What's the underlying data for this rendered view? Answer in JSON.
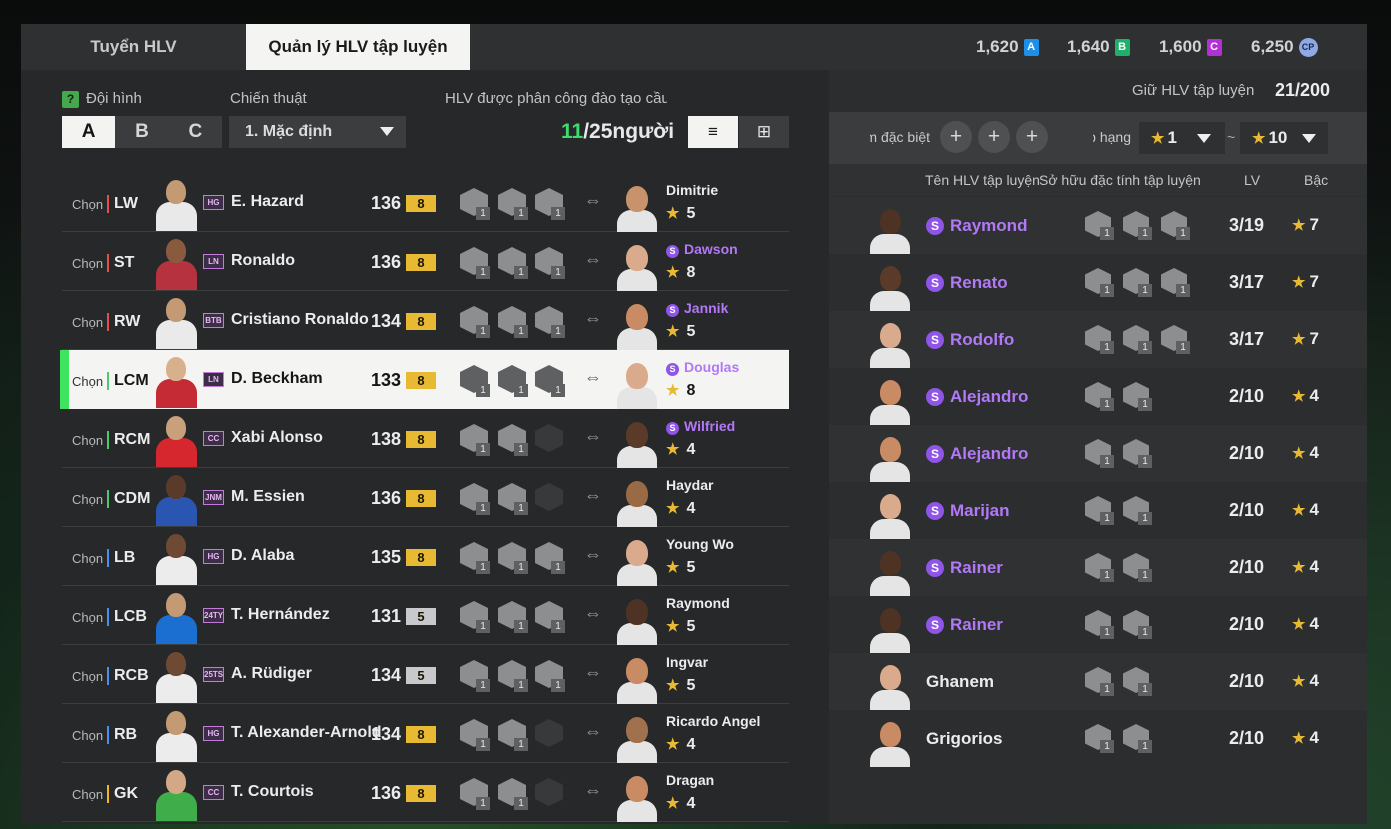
{
  "tabs": {
    "recruit": "Tuyển HLV",
    "manage": "Quản lý HLV tập luyện"
  },
  "currencies": [
    {
      "value": "1,620",
      "icon": "A",
      "color": "#1e8fe8"
    },
    {
      "value": "1,640",
      "icon": "B",
      "color": "#1fb06a"
    },
    {
      "value": "1,600",
      "icon": "C",
      "color": "#b32fd6"
    },
    {
      "value": "6,250",
      "icon": "CP",
      "color": "#8ea9e4"
    }
  ],
  "left": {
    "squad_label": "Đội hình",
    "help_icon": "?",
    "squads": [
      "A",
      "B",
      "C"
    ],
    "tactic_label": "Chiến thuật",
    "tactic_value": "1. Mặc định",
    "assigned_label": "HLV được phân công đào tạo cầu thủ",
    "assigned_count": "11",
    "assigned_total": "/25người",
    "view_list_icon": "≡",
    "view_field_icon": "⊞",
    "select_label": "Chọn"
  },
  "players": [
    {
      "pos": "LW",
      "line": "f",
      "card": "HG",
      "name": "E. Hazard",
      "ovr": "136",
      "lvl": "8",
      "grey": false,
      "coach": "Dimitrie",
      "coach_special": false,
      "coach_star": "5",
      "kit": "#e9e9e9",
      "skin": "#c49a75",
      "cskin": "#c8926a",
      "traits": 3,
      "sel": false
    },
    {
      "pos": "ST",
      "line": "f",
      "card": "LN",
      "name": "Ronaldo",
      "ovr": "136",
      "lvl": "8",
      "grey": false,
      "coach": "Dawson",
      "coach_special": true,
      "coach_star": "8",
      "kit": "#b7323f",
      "skin": "#8a5a3f",
      "cskin": "#d9ab8c",
      "traits": 3,
      "sel": false
    },
    {
      "pos": "RW",
      "line": "f",
      "card": "BTB",
      "name": "Cristiano Ronaldo",
      "ovr": "134",
      "lvl": "8",
      "grey": false,
      "coach": "Jannik",
      "coach_special": true,
      "coach_star": "5",
      "kit": "#eaeaea",
      "skin": "#c49a75",
      "cskin": "#c98b63",
      "traits": 3,
      "sel": false
    },
    {
      "pos": "LCM",
      "line": "m",
      "card": "LN",
      "name": "D. Beckham",
      "ovr": "133",
      "lvl": "8",
      "grey": false,
      "coach": "Douglas",
      "coach_special": true,
      "coach_star": "8",
      "kit": "#c42b34",
      "skin": "#d9b08c",
      "cskin": "#d9ab8c",
      "traits": 3,
      "sel": true
    },
    {
      "pos": "RCM",
      "line": "m",
      "card": "CC",
      "name": "Xabi Alonso",
      "ovr": "138",
      "lvl": "8",
      "grey": false,
      "coach": "Wilfried",
      "coach_special": true,
      "coach_star": "4",
      "kit": "#d6272e",
      "skin": "#c9a07c",
      "cskin": "#5a3a28",
      "traits": 2,
      "sel": false
    },
    {
      "pos": "CDM",
      "line": "m",
      "card": "JNM",
      "name": "M. Essien",
      "ovr": "136",
      "lvl": "8",
      "grey": false,
      "coach": "Haydar",
      "coach_special": false,
      "coach_star": "4",
      "kit": "#2a55b0",
      "skin": "#5a3a28",
      "cskin": "#9a6a45",
      "traits": 2,
      "sel": false
    },
    {
      "pos": "LB",
      "line": "d",
      "card": "HG",
      "name": "D. Alaba",
      "ovr": "135",
      "lvl": "8",
      "grey": false,
      "coach": "Young Wo",
      "coach_special": false,
      "coach_star": "5",
      "kit": "#ececec",
      "skin": "#6e4a34",
      "cskin": "#d9ab8c",
      "traits": 3,
      "sel": false
    },
    {
      "pos": "LCB",
      "line": "d",
      "card": "24TY",
      "name": "T. Hernández",
      "ovr": "131",
      "lvl": "5",
      "grey": true,
      "coach": "Raymond",
      "coach_special": false,
      "coach_star": "5",
      "kit": "#1a6fd1",
      "skin": "#c49a75",
      "cskin": "#4e3224",
      "traits": 3,
      "sel": false
    },
    {
      "pos": "RCB",
      "line": "d",
      "card": "25TS",
      "name": "A. Rüdiger",
      "ovr": "134",
      "lvl": "5",
      "grey": true,
      "coach": "Ingvar",
      "coach_special": false,
      "coach_star": "5",
      "kit": "#ececec",
      "skin": "#6e4a34",
      "cskin": "#c98b63",
      "traits": 3,
      "sel": false
    },
    {
      "pos": "RB",
      "line": "d",
      "card": "HG",
      "name": "T. Alexander-Arnold",
      "ovr": "134",
      "lvl": "8",
      "grey": false,
      "coach": "Ricardo Angel",
      "coach_special": false,
      "coach_star": "4",
      "kit": "#ececec",
      "skin": "#c49a75",
      "cskin": "#a0714c",
      "traits": 2,
      "sel": false
    },
    {
      "pos": "GK",
      "line": "g",
      "card": "CC",
      "name": "T. Courtois",
      "ovr": "136",
      "lvl": "8",
      "grey": false,
      "coach": "Dragan",
      "coach_special": false,
      "coach_star": "4",
      "kit": "#3fae4a",
      "skin": "#d3a886",
      "cskin": "#c98b63",
      "traits": 2,
      "sel": false
    }
  ],
  "right": {
    "keep_label": "Giữ HLV tập luyện",
    "keep_count": "21/200",
    "trait_filter_label": "Đặc điểm đặc biệt",
    "rank_label": "Xếp hạng",
    "rank_from": "1",
    "rank_sep": "~",
    "rank_to": "10",
    "headers": {
      "name": "Tên HLV tập luyện",
      "traits": "Sở hữu đặc tính tập luyện",
      "lv": "LV",
      "grade": "Bậc"
    }
  },
  "coaches": [
    {
      "name": "Raymond",
      "special": true,
      "lv": "3/19",
      "grade": "7",
      "traits": 3,
      "skin": "#4e3224"
    },
    {
      "name": "Renato",
      "special": true,
      "lv": "3/17",
      "grade": "7",
      "traits": 3,
      "skin": "#5a3a28"
    },
    {
      "name": "Rodolfo",
      "special": true,
      "lv": "3/17",
      "grade": "7",
      "traits": 3,
      "skin": "#d9ab8c"
    },
    {
      "name": "Alejandro",
      "special": true,
      "lv": "2/10",
      "grade": "4",
      "traits": 2,
      "skin": "#c98b63"
    },
    {
      "name": "Alejandro",
      "special": true,
      "lv": "2/10",
      "grade": "4",
      "traits": 2,
      "skin": "#c98b63"
    },
    {
      "name": "Marijan",
      "special": true,
      "lv": "2/10",
      "grade": "4",
      "traits": 2,
      "skin": "#d9ab8c"
    },
    {
      "name": "Rainer",
      "special": true,
      "lv": "2/10",
      "grade": "4",
      "traits": 2,
      "skin": "#4e3224"
    },
    {
      "name": "Rainer",
      "special": true,
      "lv": "2/10",
      "grade": "4",
      "traits": 2,
      "skin": "#4e3224"
    },
    {
      "name": "Ghanem",
      "special": false,
      "lv": "2/10",
      "grade": "4",
      "traits": 2,
      "skin": "#d9ab8c"
    },
    {
      "name": "Grigorios",
      "special": false,
      "lv": "2/10",
      "grade": "4",
      "traits": 2,
      "skin": "#c98b63"
    }
  ]
}
